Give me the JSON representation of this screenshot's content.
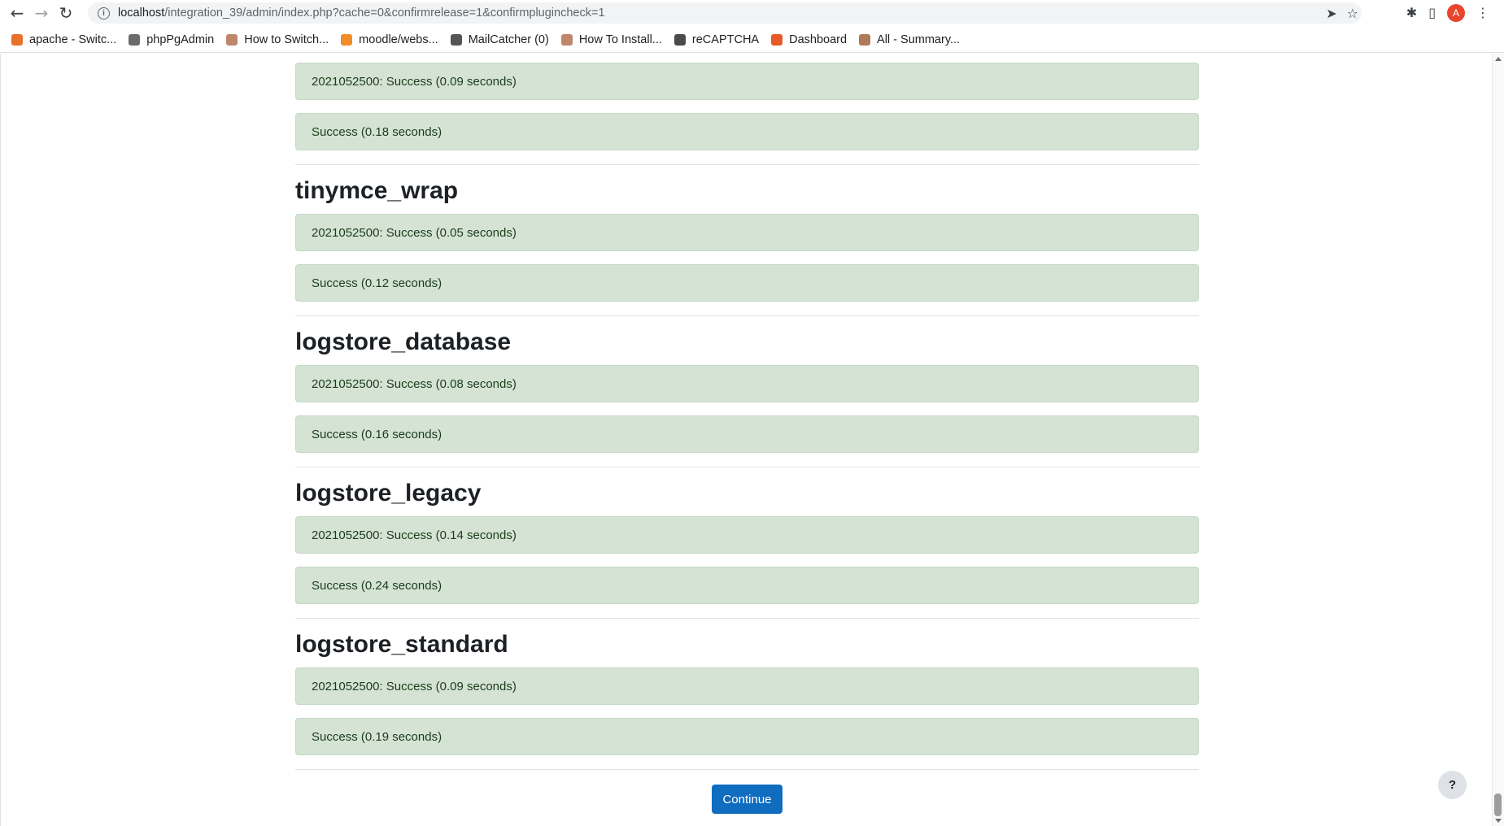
{
  "browser": {
    "url_host": "localhost",
    "url_path": "/integration_39/admin/index.php?cache=0&confirmrelease=1&confirmplugincheck=1",
    "profile_initial": "A",
    "bookmarks": [
      {
        "label": "apache - Switc...",
        "color": "#e8712c"
      },
      {
        "label": "phpPgAdmin",
        "color": "#6b6b6b"
      },
      {
        "label": "How to Switch...",
        "color": "#c0866b"
      },
      {
        "label": "moodle/webs...",
        "color": "#f28c28"
      },
      {
        "label": "MailCatcher (0)",
        "color": "#555555"
      },
      {
        "label": "How To Install...",
        "color": "#c0866b"
      },
      {
        "label": "reCAPTCHA",
        "color": "#4a4a4a"
      },
      {
        "label": "Dashboard",
        "color": "#e65a2a"
      },
      {
        "label": "All - Summary...",
        "color": "#b07a5a"
      }
    ]
  },
  "page": {
    "top_results": [
      "2021052500: Success (0.09 seconds)",
      "Success (0.18 seconds)"
    ],
    "sections": [
      {
        "title": "tinymce_wrap",
        "results": [
          "2021052500: Success (0.05 seconds)",
          "Success (0.12 seconds)"
        ]
      },
      {
        "title": "logstore_database",
        "results": [
          "2021052500: Success (0.08 seconds)",
          "Success (0.16 seconds)"
        ]
      },
      {
        "title": "logstore_legacy",
        "results": [
          "2021052500: Success (0.14 seconds)",
          "Success (0.24 seconds)"
        ]
      },
      {
        "title": "logstore_standard",
        "results": [
          "2021052500: Success (0.09 seconds)",
          "Success (0.19 seconds)"
        ]
      }
    ],
    "continue_label": "Continue",
    "help_label": "?"
  },
  "colors": {
    "success_bg": "#d4e3d4",
    "primary": "#0f6cbf"
  }
}
